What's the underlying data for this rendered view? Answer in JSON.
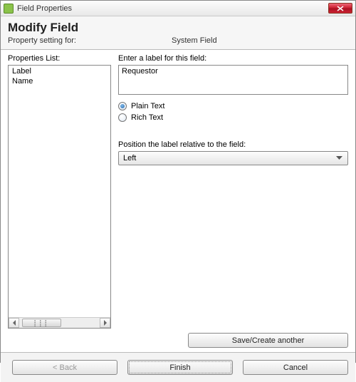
{
  "window": {
    "title": "Field Properties"
  },
  "header": {
    "title": "Modify Field",
    "setting_label": "Property setting for:",
    "setting_value": "System Field"
  },
  "left": {
    "list_label": "Properties List:",
    "items": [
      "Label",
      "Name"
    ],
    "thumb_glyph": "⡇⡇⡇"
  },
  "right": {
    "label_prompt": "Enter a label for this field:",
    "label_value": "Requestor",
    "radio_plain": "Plain Text",
    "radio_rich": "Rich Text",
    "pos_prompt": "Position the label relative to the field:",
    "pos_value": "Left"
  },
  "buttons": {
    "save_create": "Save/Create another",
    "back": "< Back",
    "finish": "Finish",
    "cancel": "Cancel"
  }
}
